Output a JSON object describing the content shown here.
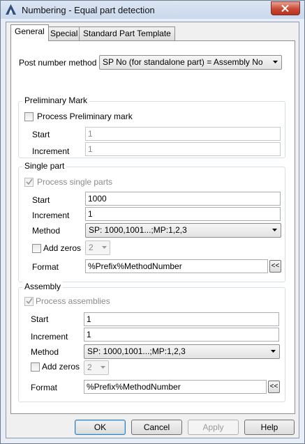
{
  "window": {
    "title": "Numbering - Equal part detection"
  },
  "tabs": [
    "General",
    "Special",
    "Standard Part Template"
  ],
  "post_number": {
    "label": "Post number method",
    "value": "SP No (for standalone part) = Assembly No"
  },
  "preliminary": {
    "group_title": "Preliminary Mark",
    "checkbox_label": "Process Preliminary mark",
    "checked": false,
    "start_label": "Start",
    "start_value": "1",
    "increment_label": "Increment",
    "increment_value": "1"
  },
  "single_part": {
    "group_title": "Single part",
    "checkbox_label": "Process single parts",
    "checked": true,
    "start_label": "Start",
    "start_value": "1000",
    "increment_label": "Increment",
    "increment_value": "1",
    "method_label": "Method",
    "method_value": "SP: 1000,1001...;MP:1,2,3",
    "add_zeros_label": "Add zeros",
    "add_zeros_value": "2",
    "format_label": "Format",
    "format_value": "%Prefix%MethodNumber",
    "format_button": "<<"
  },
  "assembly": {
    "group_title": "Assembly",
    "checkbox_label": "Process assemblies",
    "checked": true,
    "start_label": "Start",
    "start_value": "1",
    "increment_label": "Increment",
    "increment_value": "1",
    "method_label": "Method",
    "method_value": "SP: 1000,1001...;MP:1,2,3",
    "add_zeros_label": "Add zeros",
    "add_zeros_value": "2",
    "format_label": "Format",
    "format_value": "%Prefix%MethodNumber",
    "format_button": "<<"
  },
  "buttons": {
    "ok": "OK",
    "cancel": "Cancel",
    "apply": "Apply",
    "help": "Help"
  },
  "colors": {
    "title_bar": "#c9d8ec",
    "close_button": "#c94a35",
    "group_border": "#d5dfe5",
    "disabled_text": "#8a8a8a"
  }
}
